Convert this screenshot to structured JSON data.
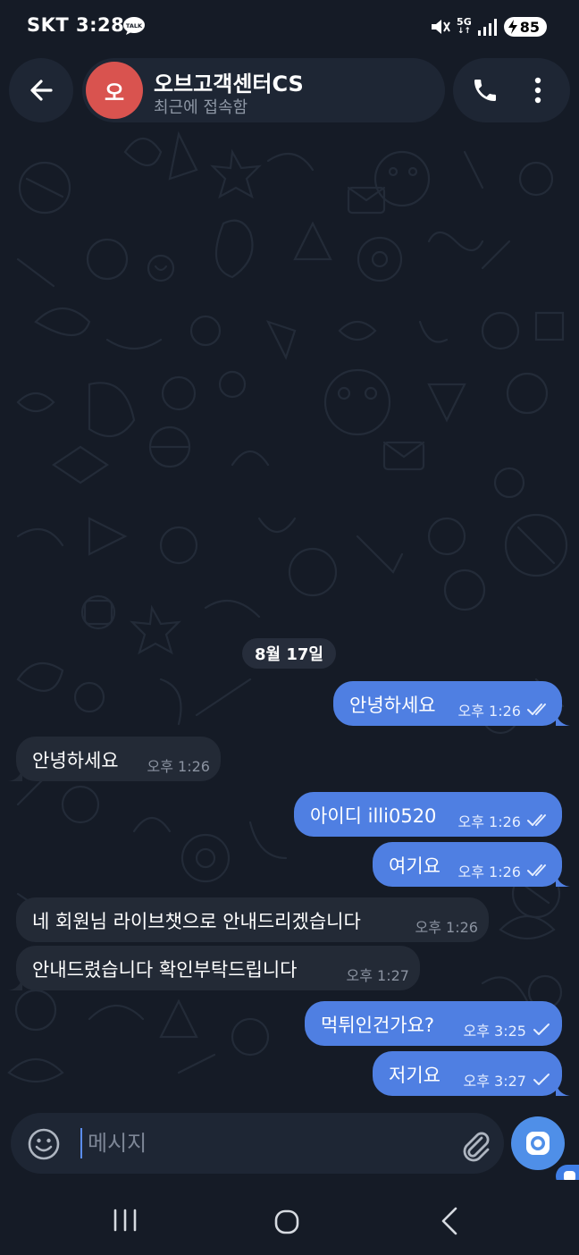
{
  "status_bar": {
    "carrier": "SKT",
    "time": "3:28",
    "talk_badge": "TALK",
    "network": "5G",
    "battery": "85"
  },
  "header": {
    "avatar_letter": "오",
    "name": "오브고객센터CS",
    "status": "최근에 접속함"
  },
  "date_divider": "8월 17일",
  "messages": [
    {
      "direction": "out",
      "text": "안녕하세요",
      "time": "오후 1:26",
      "receipt": "read"
    },
    {
      "direction": "in",
      "text": "안녕하세요",
      "time": "오후 1:26"
    },
    {
      "direction": "out",
      "text": "아이디 illi0520",
      "time": "오후 1:26",
      "receipt": "read"
    },
    {
      "direction": "out",
      "text": "여기요",
      "time": "오후 1:26",
      "receipt": "read"
    },
    {
      "direction": "in",
      "text": "네 회원님 라이브챗으로 안내드리겠습니다",
      "time": "오후 1:26"
    },
    {
      "direction": "in",
      "text": "안내드렸습니다 확인부탁드립니다",
      "time": "오후 1:27"
    },
    {
      "direction": "out",
      "text": "먹튀인건가요?",
      "time": "오후 3:25",
      "receipt": "sent"
    },
    {
      "direction": "out",
      "text": "저기요",
      "time": "오후 3:27",
      "receipt": "sent"
    }
  ],
  "composer": {
    "placeholder": "메시지"
  },
  "colors": {
    "background": "#151b26",
    "outgoing_bubble": "#4f7fe2",
    "incoming_bubble": "#232a36",
    "avatar": "#d9534f",
    "accent": "#4f8fe8"
  },
  "icons": [
    "back-arrow-icon",
    "phone-icon",
    "more-vert-icon",
    "emoji-icon",
    "attach-icon",
    "camera-icon",
    "double-check-icon",
    "single-check-icon",
    "recent-apps-icon",
    "home-icon",
    "nav-back-icon"
  ]
}
